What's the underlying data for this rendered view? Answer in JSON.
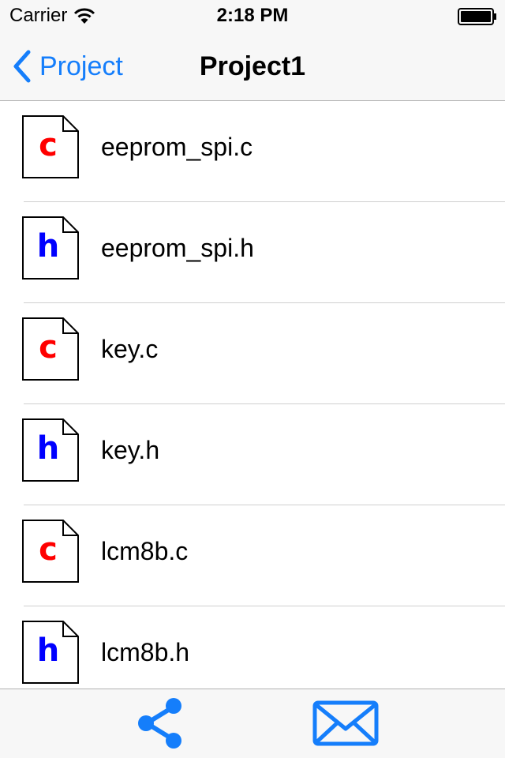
{
  "status_bar": {
    "carrier": "Carrier",
    "time": "2:18 PM",
    "icons": [
      "wifi-icon",
      "battery-icon"
    ]
  },
  "nav": {
    "back_label": "Project",
    "title": "Project1",
    "back_icon": "chevron-left-icon"
  },
  "files": [
    {
      "name": "eeprom_spi.c",
      "type": "c",
      "color": "#ff0000"
    },
    {
      "name": "eeprom_spi.h",
      "type": "h",
      "color": "#0000ff"
    },
    {
      "name": "key.c",
      "type": "c",
      "color": "#ff0000"
    },
    {
      "name": "key.h",
      "type": "h",
      "color": "#0000ff"
    },
    {
      "name": "lcm8b.c",
      "type": "c",
      "color": "#ff0000"
    },
    {
      "name": "lcm8b.h",
      "type": "h",
      "color": "#0000ff"
    }
  ],
  "toolbar": {
    "icons": [
      "share-icon",
      "mail-icon"
    ]
  },
  "colors": {
    "accent": "#157efb",
    "bar_background": "#f7f7f7",
    "separator": "#cfcfcf"
  }
}
